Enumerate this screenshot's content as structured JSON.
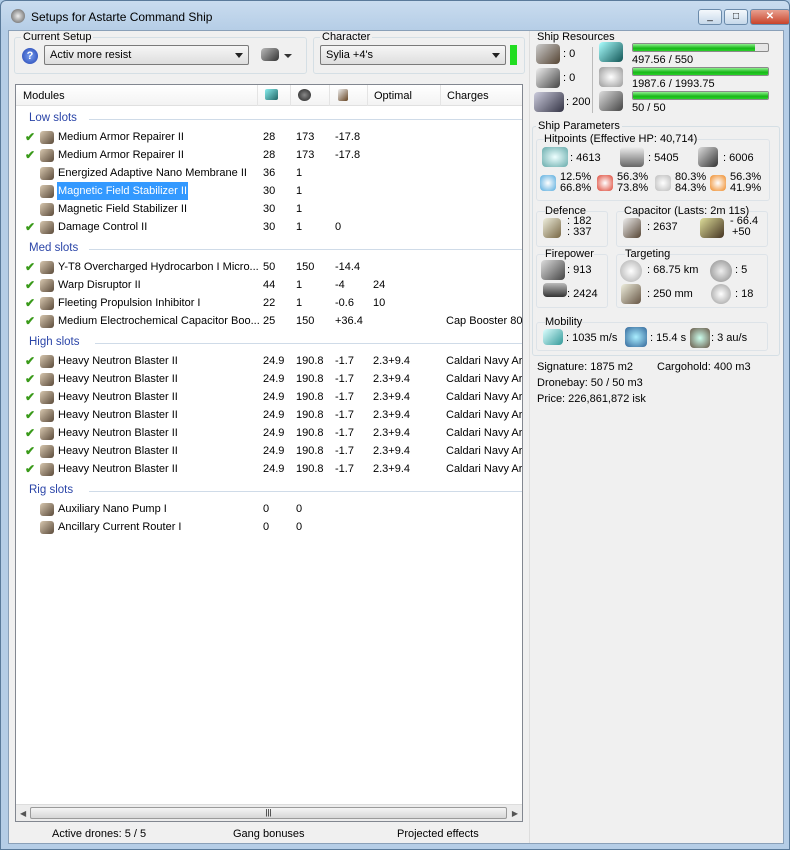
{
  "window": {
    "title": "Setups for Astarte Command Ship",
    "min": "_",
    "max": "□",
    "close": "✕"
  },
  "setup": {
    "label": "Current Setup",
    "value": "Activ more resist",
    "help_icon": "help-icon",
    "ship_menu_icon": "ship-icon"
  },
  "character": {
    "label": "Character",
    "value": "Sylia +4's",
    "status_color": "#22dd22"
  },
  "modules": {
    "headers": [
      "Modules",
      "cpu-icon",
      "powergrid-icon",
      "capacitor-icon",
      "Optimal",
      "Charges"
    ],
    "sections": [
      {
        "title": "Low slots",
        "rows": [
          {
            "active": true,
            "name": "Medium Armor Repairer II",
            "cpu": "28",
            "pg": "173",
            "cap": "-17.8",
            "optimal": "",
            "charges": ""
          },
          {
            "active": true,
            "name": "Medium Armor Repairer II",
            "cpu": "28",
            "pg": "173",
            "cap": "-17.8",
            "optimal": "",
            "charges": ""
          },
          {
            "active": false,
            "name": "Energized Adaptive Nano Membrane II",
            "cpu": "36",
            "pg": "1",
            "cap": "",
            "optimal": "",
            "charges": ""
          },
          {
            "active": false,
            "selected": true,
            "name": "Magnetic Field Stabilizer II",
            "cpu": "30",
            "pg": "1",
            "cap": "",
            "optimal": "",
            "charges": ""
          },
          {
            "active": false,
            "name": "Magnetic Field Stabilizer II",
            "cpu": "30",
            "pg": "1",
            "cap": "",
            "optimal": "",
            "charges": ""
          },
          {
            "active": true,
            "name": "Damage Control II",
            "cpu": "30",
            "pg": "1",
            "cap": "0",
            "optimal": "",
            "charges": ""
          }
        ]
      },
      {
        "title": "Med slots",
        "rows": [
          {
            "active": true,
            "name": "Y-T8 Overcharged Hydrocarbon I Micro...",
            "cpu": "50",
            "pg": "150",
            "cap": "-14.4",
            "optimal": "",
            "charges": ""
          },
          {
            "active": true,
            "name": "Warp Disruptor II",
            "cpu": "44",
            "pg": "1",
            "cap": "-4",
            "optimal": "24",
            "charges": ""
          },
          {
            "active": true,
            "name": "Fleeting Propulsion Inhibitor I",
            "cpu": "22",
            "pg": "1",
            "cap": "-0.6",
            "optimal": "10",
            "charges": ""
          },
          {
            "active": true,
            "name": "Medium Electrochemical Capacitor Boo...",
            "cpu": "25",
            "pg": "150",
            "cap": "+36.4",
            "optimal": "",
            "charges": "Cap Booster 80"
          }
        ]
      },
      {
        "title": "High slots",
        "rows": [
          {
            "active": true,
            "name": "Heavy Neutron Blaster II",
            "cpu": "24.9",
            "pg": "190.8",
            "cap": "-1.7",
            "optimal": "2.3+9.4",
            "charges": "Caldari Navy Ar"
          },
          {
            "active": true,
            "name": "Heavy Neutron Blaster II",
            "cpu": "24.9",
            "pg": "190.8",
            "cap": "-1.7",
            "optimal": "2.3+9.4",
            "charges": "Caldari Navy Ar"
          },
          {
            "active": true,
            "name": "Heavy Neutron Blaster II",
            "cpu": "24.9",
            "pg": "190.8",
            "cap": "-1.7",
            "optimal": "2.3+9.4",
            "charges": "Caldari Navy Ar"
          },
          {
            "active": true,
            "name": "Heavy Neutron Blaster II",
            "cpu": "24.9",
            "pg": "190.8",
            "cap": "-1.7",
            "optimal": "2.3+9.4",
            "charges": "Caldari Navy Ar"
          },
          {
            "active": true,
            "name": "Heavy Neutron Blaster II",
            "cpu": "24.9",
            "pg": "190.8",
            "cap": "-1.7",
            "optimal": "2.3+9.4",
            "charges": "Caldari Navy Ar"
          },
          {
            "active": true,
            "name": "Heavy Neutron Blaster II",
            "cpu": "24.9",
            "pg": "190.8",
            "cap": "-1.7",
            "optimal": "2.3+9.4",
            "charges": "Caldari Navy Ar"
          },
          {
            "active": true,
            "name": "Heavy Neutron Blaster II",
            "cpu": "24.9",
            "pg": "190.8",
            "cap": "-1.7",
            "optimal": "2.3+9.4",
            "charges": "Caldari Navy Ar"
          }
        ]
      },
      {
        "title": "Rig slots",
        "rows": [
          {
            "active": false,
            "name": "Auxiliary Nano Pump I",
            "cpu": "0",
            "pg": "0",
            "cap": "",
            "optimal": "",
            "charges": ""
          },
          {
            "active": false,
            "name": "Ancillary Current Router I",
            "cpu": "0",
            "pg": "0",
            "cap": "",
            "optimal": "",
            "charges": ""
          }
        ]
      }
    ]
  },
  "status": {
    "drones": "Active drones: 5 / 5",
    "gang": "Gang bonuses",
    "projected": "Projected effects"
  },
  "resources": {
    "label": "Ship Resources",
    "turrets": ": 0",
    "launchers": ": 0",
    "calibration": ": 200",
    "cpu": {
      "text": "497.56 / 550",
      "fraction": 0.905
    },
    "powergrid": {
      "text": "1987.6 / 1993.75",
      "fraction": 0.997
    },
    "drone_bandwidth": {
      "text": "50 / 50",
      "fraction": 1.0
    }
  },
  "parameters": {
    "label": "Ship Parameters",
    "hitpoints": {
      "label": "Hitpoints (Effective HP: 40,714)",
      "shield": ": 4613",
      "armor": ": 5405",
      "structure": ": 6006",
      "em": [
        "12.5%",
        "66.8%"
      ],
      "thermal": [
        "56.3%",
        "73.8%"
      ],
      "kinetic": [
        "80.3%",
        "84.3%"
      ],
      "explosive": [
        "56.3%",
        "41.9%"
      ]
    },
    "defence": {
      "label": "Defence",
      "a": ": 182",
      "b": ": 337"
    },
    "capacitor": {
      "label": "Capacitor (Lasts: 2m 11s)",
      "amount": ": 2637",
      "use": "- 66.4",
      "recharge": "+50"
    },
    "firepower": {
      "label": "Firepower",
      "turret": ": 913",
      "volley": ": 2424"
    },
    "targeting": {
      "label": "Targeting",
      "range": ": 68.75 km",
      "targets": ": 5",
      "resolution": ": 250 mm",
      "sensor": ": 18"
    },
    "mobility": {
      "label": "Mobility",
      "speed": ": 1035 m/s",
      "align": ": 15.4 s",
      "warp": ": 3 au/s"
    },
    "signature": "Signature: 1875 m2",
    "cargohold": "Cargohold: 400 m3",
    "dronebay": "Dronebay: 50 / 50 m3",
    "price": "Price: 226,861,872 isk"
  }
}
